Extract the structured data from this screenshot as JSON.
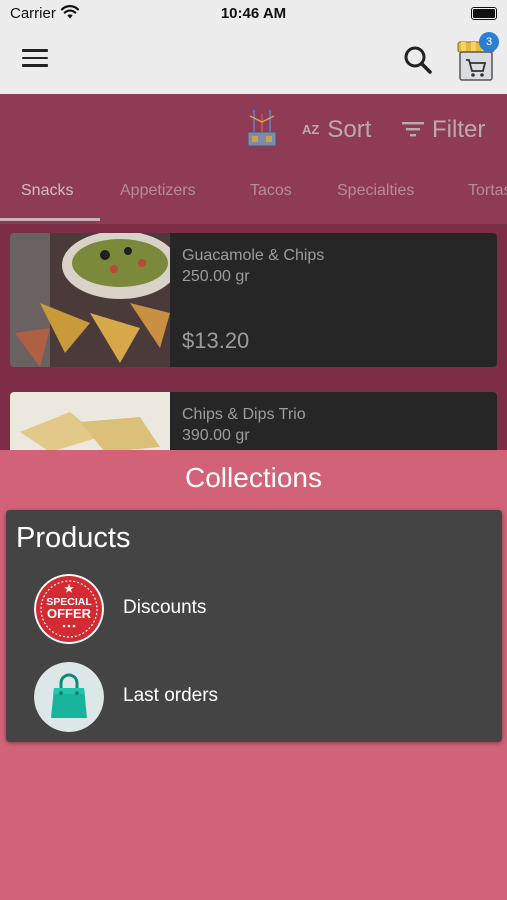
{
  "status_bar": {
    "carrier": "Carrier",
    "time": "10:46 AM"
  },
  "app_bar": {
    "cart_count": "3"
  },
  "toolbar": {
    "sort_az": "AZ",
    "sort_label": "Sort",
    "filter_label": "Filter"
  },
  "tabs": [
    {
      "label": "Snacks",
      "active": true
    },
    {
      "label": "Appetizers"
    },
    {
      "label": "Tacos"
    },
    {
      "label": "Specialties"
    },
    {
      "label": "Tortas"
    }
  ],
  "products": [
    {
      "name": "Guacamole & Chips",
      "weight": "250.00 gr",
      "price": "$13.20"
    },
    {
      "name": "Chips & Dips Trio",
      "weight": "390.00 gr"
    }
  ],
  "sheet": {
    "title": "Collections",
    "panel_heading": "Products",
    "items": [
      {
        "label": "Discounts",
        "badge_line1": "SPECIAL",
        "badge_line2": "OFFER"
      },
      {
        "label": "Last orders"
      }
    ]
  },
  "colors": {
    "sheet": "#d26277",
    "panel": "#444444",
    "band": "#8f3b55",
    "list_bg": "#7e2d47",
    "badge": "#2a7fd4",
    "offer_red": "#d42a32"
  }
}
